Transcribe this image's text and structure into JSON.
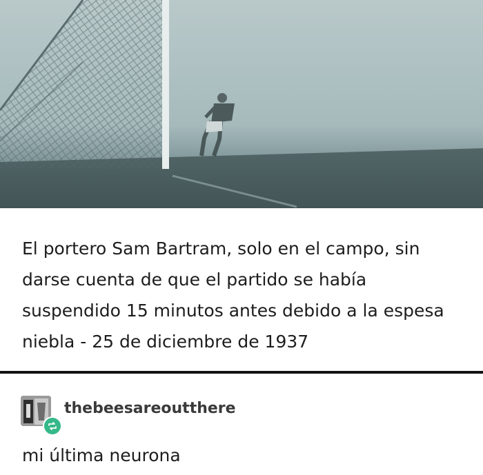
{
  "post": {
    "image_alt_subject": "goalkeeper-in-fog-photo",
    "caption": "El portero Sam Bartram, solo en el campo, sin darse cuenta de que el partido se había suspendido 15 minutos antes debido a la espesa niebla - 25 de diciembre de 1937"
  },
  "reblog": {
    "username": "thebeesareoutthere",
    "comment": "mi última neurona",
    "badge_icon": "reblog-icon",
    "badge_color": "#35b88a"
  }
}
